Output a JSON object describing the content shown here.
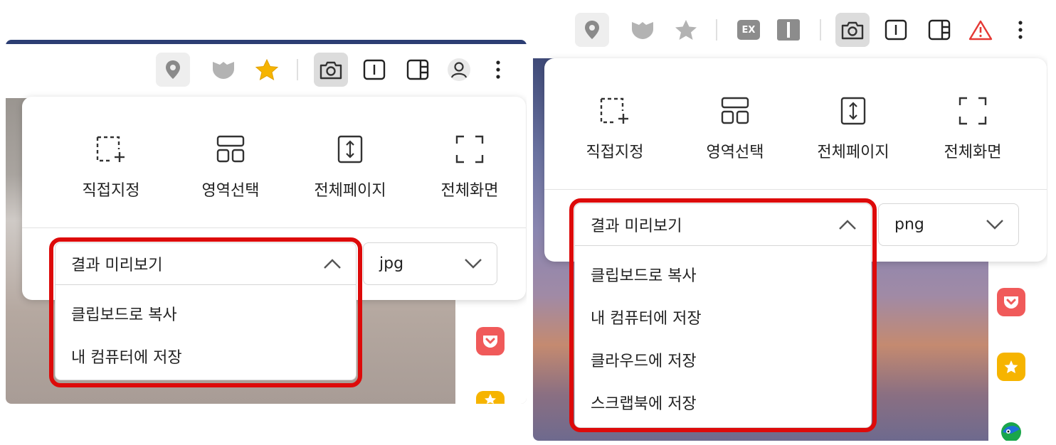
{
  "left": {
    "toolbar_icons": [
      "location-icon",
      "shield-icon",
      "star-icon",
      "camera-icon",
      "reader-mode-icon",
      "sidebar-icon",
      "profile-icon",
      "more-icon"
    ],
    "capture_modes": [
      {
        "icon": "dashed-select-icon",
        "label": "직접지정"
      },
      {
        "icon": "area-select-icon",
        "label": "영역선택"
      },
      {
        "icon": "full-page-icon",
        "label": "전체페이지"
      },
      {
        "icon": "full-screen-icon",
        "label": "전체화면"
      }
    ],
    "preview_select": {
      "value": "결과 미리보기"
    },
    "format_select": {
      "value": "jpg"
    },
    "menu_items": [
      "클립보드로 복사",
      "내 컴퓨터에 저장"
    ]
  },
  "right": {
    "toolbar_icons": [
      "location-icon",
      "shield-icon",
      "star-icon",
      "ex-extension-icon",
      "cursor-extension-icon",
      "camera-icon",
      "reader-mode-icon",
      "sidebar-icon",
      "warning-icon",
      "more-icon"
    ],
    "capture_modes": [
      {
        "icon": "dashed-select-icon",
        "label": "직접지정"
      },
      {
        "icon": "area-select-icon",
        "label": "영역선택"
      },
      {
        "icon": "full-page-icon",
        "label": "전체페이지"
      },
      {
        "icon": "full-screen-icon",
        "label": "전체화면"
      }
    ],
    "preview_select": {
      "value": "결과 미리보기"
    },
    "format_select": {
      "value": "png"
    },
    "menu_items": [
      "클립보드로 복사",
      "내 컴퓨터에 저장",
      "클라우드에 저장",
      "스크랩북에 저장"
    ],
    "ex_label": "EX"
  },
  "colors": {
    "highlight": "#dd0a0a",
    "star": "#f6b400",
    "pocket": "#f05a5a",
    "warning": "#e53935"
  }
}
